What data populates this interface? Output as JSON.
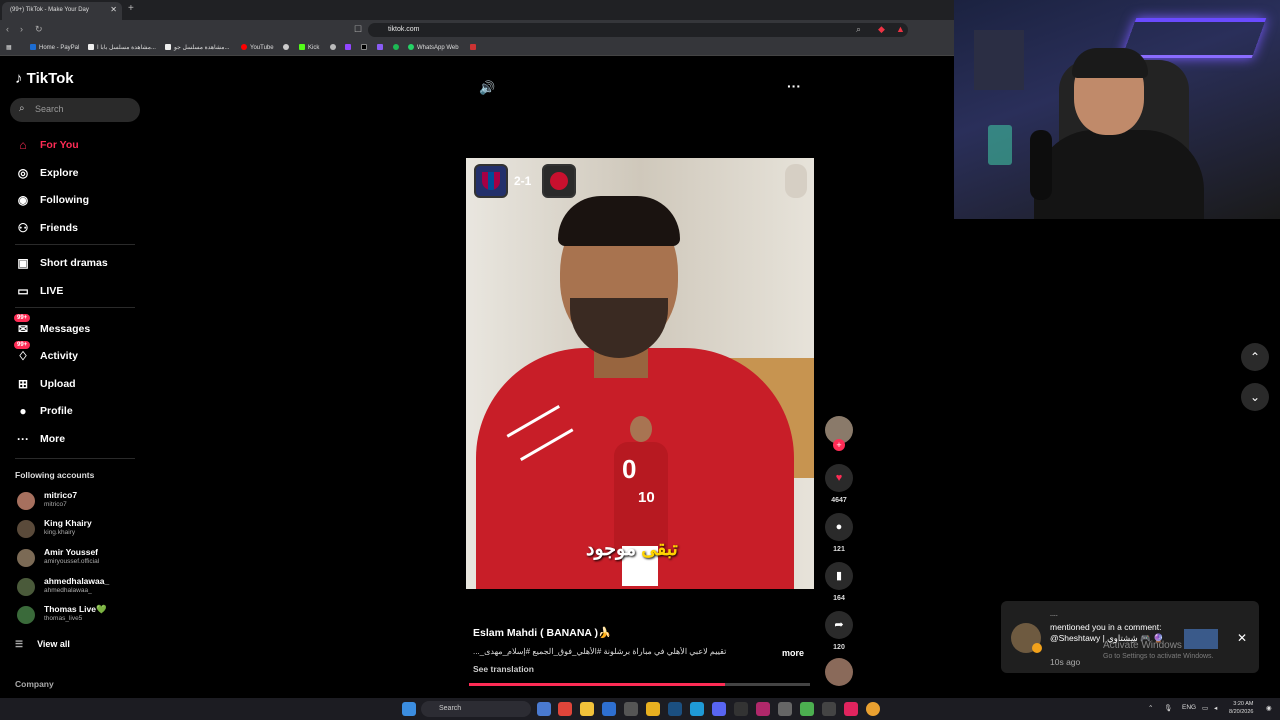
{
  "browser": {
    "tab_title": "(99+) TikTok - Make Your Day",
    "url": "tiktok.com",
    "bookmarks": [
      "Home - PayPal",
      "مشاهدة مسلسل بابا ا...",
      "مشاهدة مسلسل جو...",
      "YouTube",
      "Kick",
      "WhatsApp Web"
    ]
  },
  "sidebar": {
    "logo": "TikTok",
    "search_placeholder": "Search",
    "nav": [
      {
        "label": "For You",
        "icon": "home-icon",
        "active": true
      },
      {
        "label": "Explore",
        "icon": "compass-icon"
      },
      {
        "label": "Following",
        "icon": "following-icon"
      },
      {
        "label": "Friends",
        "icon": "friends-icon"
      },
      {
        "label": "Short dramas",
        "icon": "film-icon"
      },
      {
        "label": "LIVE",
        "icon": "live-icon"
      },
      {
        "label": "Messages",
        "icon": "message-icon",
        "badge": "99+"
      },
      {
        "label": "Activity",
        "icon": "bell-icon",
        "badge": "99+"
      },
      {
        "label": "Upload",
        "icon": "upload-icon"
      },
      {
        "label": "Profile",
        "icon": "profile-icon"
      },
      {
        "label": "More",
        "icon": "more-icon"
      }
    ],
    "following_title": "Following accounts",
    "accounts": [
      {
        "name": "mitrico7",
        "handle": "mitrico7"
      },
      {
        "name": "King Khairy",
        "handle": "king.khairy"
      },
      {
        "name": "Amir Youssef",
        "handle": "amiryoussef.official"
      },
      {
        "name": "ahmedhalawaa_",
        "handle": "ahmedhalawaa_"
      },
      {
        "name": "Thomas Live💚",
        "handle": "thomas_live5"
      }
    ],
    "view_all": "View all",
    "company": "Company"
  },
  "video": {
    "score": "2-1",
    "jersey_number_1": "0",
    "jersey_number_2": "10",
    "caption_white": "موجود",
    "caption_yellow": "تبقى",
    "author": "Eslam Mahdi ( BANANA )🍌",
    "description": "تقييم لاعبي الأهلي في مباراة برشلونة #الأهلي_فوق_الجميع #إسلام_مهدى_...",
    "more": "more",
    "see_translation": "See translation",
    "progress": 0.75
  },
  "actions": {
    "likes": "4647",
    "comments": "121",
    "saves": "164",
    "shares": "120"
  },
  "notification": {
    "from": "....",
    "text": "mentioned you in a comment: @Sheshtawy | شِشتاوي 🎮 🔮",
    "time": "10s ago"
  },
  "windows": {
    "activate_title": "Activate Windows",
    "activate_sub": "Go to Settings to activate Windows.",
    "search": "Search",
    "lang": "ENG",
    "time": "3:20 AM",
    "date": "8/20/2026"
  },
  "colors": {
    "accent": "#fe2c55"
  }
}
